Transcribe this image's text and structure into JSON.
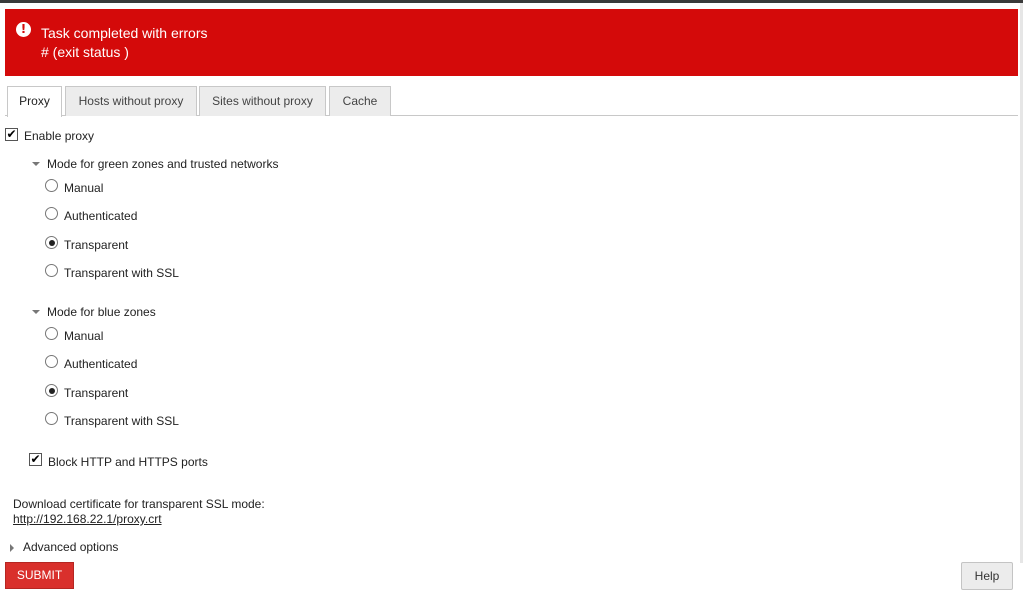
{
  "error": {
    "title": "Task completed with errors",
    "detail": "# (exit status )",
    "icon": "exclamation-circle-icon",
    "color": "#d40a0a"
  },
  "tabs": [
    {
      "label": "Proxy",
      "active": true
    },
    {
      "label": "Hosts without proxy",
      "active": false
    },
    {
      "label": "Sites without proxy",
      "active": false
    },
    {
      "label": "Cache",
      "active": false
    }
  ],
  "enable_proxy": {
    "label": "Enable proxy",
    "checked": true
  },
  "green_mode": {
    "title": "Mode for green zones and trusted networks",
    "options": [
      {
        "label": "Manual",
        "selected": false
      },
      {
        "label": "Authenticated",
        "selected": false
      },
      {
        "label": "Transparent",
        "selected": true
      },
      {
        "label": "Transparent with SSL",
        "selected": false
      }
    ]
  },
  "blue_mode": {
    "title": "Mode for blue zones",
    "options": [
      {
        "label": "Manual",
        "selected": false
      },
      {
        "label": "Authenticated",
        "selected": false
      },
      {
        "label": "Transparent",
        "selected": true
      },
      {
        "label": "Transparent with SSL",
        "selected": false
      }
    ]
  },
  "block_ports": {
    "label": "Block HTTP and HTTPS ports",
    "checked": true
  },
  "certificate": {
    "text": "Download certificate for transparent SSL mode:",
    "link": "http://192.168.22.1/proxy.crt"
  },
  "advanced": {
    "label": "Advanced options"
  },
  "buttons": {
    "submit": "SUBMIT",
    "help": "Help"
  },
  "colors": {
    "accent": "#d9302c"
  }
}
